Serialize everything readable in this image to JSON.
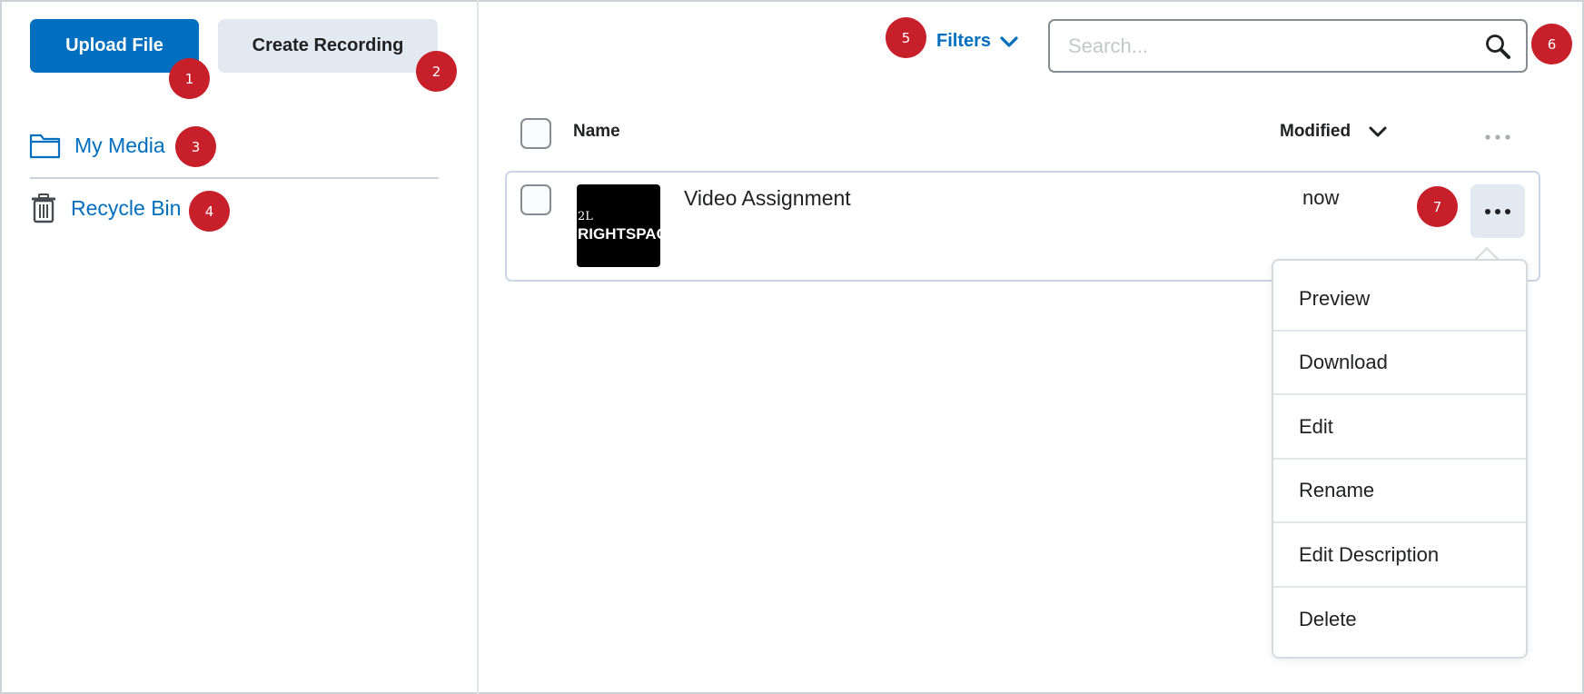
{
  "toolbar": {
    "upload_label": "Upload File",
    "record_label": "Create Recording"
  },
  "sidebar": {
    "items": [
      {
        "label": "My Media",
        "icon": "folder-icon"
      },
      {
        "label": "Recycle Bin",
        "icon": "trash-icon"
      }
    ]
  },
  "filters": {
    "label": "Filters"
  },
  "search": {
    "placeholder": "Search..."
  },
  "table": {
    "columns": {
      "name": "Name",
      "modified": "Modified"
    },
    "rows": [
      {
        "title": "Video Assignment",
        "modified": "now",
        "thumb_mark": "2L",
        "thumb_text": "RIGHTSPAC"
      }
    ]
  },
  "menu": {
    "items": [
      "Preview",
      "Download",
      "Edit",
      "Rename",
      "Edit Description",
      "Delete"
    ]
  },
  "callouts": [
    "1",
    "2",
    "3",
    "4",
    "5",
    "6",
    "7"
  ],
  "colors": {
    "accent": "#006fbf",
    "callout": "#c8202b",
    "secondary_button": "#e3e9f1"
  }
}
